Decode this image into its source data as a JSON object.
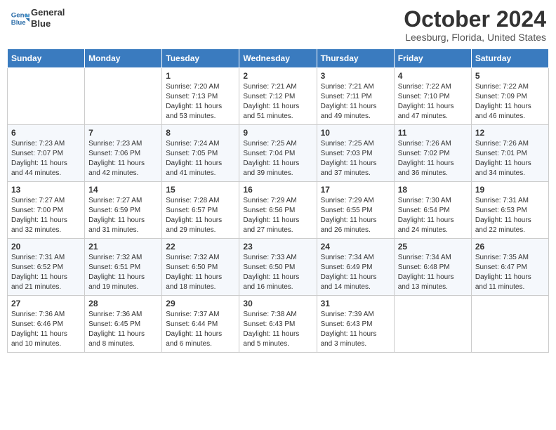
{
  "header": {
    "logo_line1": "General",
    "logo_line2": "Blue",
    "month": "October 2024",
    "location": "Leesburg, Florida, United States"
  },
  "days_of_week": [
    "Sunday",
    "Monday",
    "Tuesday",
    "Wednesday",
    "Thursday",
    "Friday",
    "Saturday"
  ],
  "weeks": [
    [
      {
        "day": "",
        "sunrise": "",
        "sunset": "",
        "daylight": ""
      },
      {
        "day": "",
        "sunrise": "",
        "sunset": "",
        "daylight": ""
      },
      {
        "day": "1",
        "sunrise": "Sunrise: 7:20 AM",
        "sunset": "Sunset: 7:13 PM",
        "daylight": "Daylight: 11 hours and 53 minutes."
      },
      {
        "day": "2",
        "sunrise": "Sunrise: 7:21 AM",
        "sunset": "Sunset: 7:12 PM",
        "daylight": "Daylight: 11 hours and 51 minutes."
      },
      {
        "day": "3",
        "sunrise": "Sunrise: 7:21 AM",
        "sunset": "Sunset: 7:11 PM",
        "daylight": "Daylight: 11 hours and 49 minutes."
      },
      {
        "day": "4",
        "sunrise": "Sunrise: 7:22 AM",
        "sunset": "Sunset: 7:10 PM",
        "daylight": "Daylight: 11 hours and 47 minutes."
      },
      {
        "day": "5",
        "sunrise": "Sunrise: 7:22 AM",
        "sunset": "Sunset: 7:09 PM",
        "daylight": "Daylight: 11 hours and 46 minutes."
      }
    ],
    [
      {
        "day": "6",
        "sunrise": "Sunrise: 7:23 AM",
        "sunset": "Sunset: 7:07 PM",
        "daylight": "Daylight: 11 hours and 44 minutes."
      },
      {
        "day": "7",
        "sunrise": "Sunrise: 7:23 AM",
        "sunset": "Sunset: 7:06 PM",
        "daylight": "Daylight: 11 hours and 42 minutes."
      },
      {
        "day": "8",
        "sunrise": "Sunrise: 7:24 AM",
        "sunset": "Sunset: 7:05 PM",
        "daylight": "Daylight: 11 hours and 41 minutes."
      },
      {
        "day": "9",
        "sunrise": "Sunrise: 7:25 AM",
        "sunset": "Sunset: 7:04 PM",
        "daylight": "Daylight: 11 hours and 39 minutes."
      },
      {
        "day": "10",
        "sunrise": "Sunrise: 7:25 AM",
        "sunset": "Sunset: 7:03 PM",
        "daylight": "Daylight: 11 hours and 37 minutes."
      },
      {
        "day": "11",
        "sunrise": "Sunrise: 7:26 AM",
        "sunset": "Sunset: 7:02 PM",
        "daylight": "Daylight: 11 hours and 36 minutes."
      },
      {
        "day": "12",
        "sunrise": "Sunrise: 7:26 AM",
        "sunset": "Sunset: 7:01 PM",
        "daylight": "Daylight: 11 hours and 34 minutes."
      }
    ],
    [
      {
        "day": "13",
        "sunrise": "Sunrise: 7:27 AM",
        "sunset": "Sunset: 7:00 PM",
        "daylight": "Daylight: 11 hours and 32 minutes."
      },
      {
        "day": "14",
        "sunrise": "Sunrise: 7:27 AM",
        "sunset": "Sunset: 6:59 PM",
        "daylight": "Daylight: 11 hours and 31 minutes."
      },
      {
        "day": "15",
        "sunrise": "Sunrise: 7:28 AM",
        "sunset": "Sunset: 6:57 PM",
        "daylight": "Daylight: 11 hours and 29 minutes."
      },
      {
        "day": "16",
        "sunrise": "Sunrise: 7:29 AM",
        "sunset": "Sunset: 6:56 PM",
        "daylight": "Daylight: 11 hours and 27 minutes."
      },
      {
        "day": "17",
        "sunrise": "Sunrise: 7:29 AM",
        "sunset": "Sunset: 6:55 PM",
        "daylight": "Daylight: 11 hours and 26 minutes."
      },
      {
        "day": "18",
        "sunrise": "Sunrise: 7:30 AM",
        "sunset": "Sunset: 6:54 PM",
        "daylight": "Daylight: 11 hours and 24 minutes."
      },
      {
        "day": "19",
        "sunrise": "Sunrise: 7:31 AM",
        "sunset": "Sunset: 6:53 PM",
        "daylight": "Daylight: 11 hours and 22 minutes."
      }
    ],
    [
      {
        "day": "20",
        "sunrise": "Sunrise: 7:31 AM",
        "sunset": "Sunset: 6:52 PM",
        "daylight": "Daylight: 11 hours and 21 minutes."
      },
      {
        "day": "21",
        "sunrise": "Sunrise: 7:32 AM",
        "sunset": "Sunset: 6:51 PM",
        "daylight": "Daylight: 11 hours and 19 minutes."
      },
      {
        "day": "22",
        "sunrise": "Sunrise: 7:32 AM",
        "sunset": "Sunset: 6:50 PM",
        "daylight": "Daylight: 11 hours and 18 minutes."
      },
      {
        "day": "23",
        "sunrise": "Sunrise: 7:33 AM",
        "sunset": "Sunset: 6:50 PM",
        "daylight": "Daylight: 11 hours and 16 minutes."
      },
      {
        "day": "24",
        "sunrise": "Sunrise: 7:34 AM",
        "sunset": "Sunset: 6:49 PM",
        "daylight": "Daylight: 11 hours and 14 minutes."
      },
      {
        "day": "25",
        "sunrise": "Sunrise: 7:34 AM",
        "sunset": "Sunset: 6:48 PM",
        "daylight": "Daylight: 11 hours and 13 minutes."
      },
      {
        "day": "26",
        "sunrise": "Sunrise: 7:35 AM",
        "sunset": "Sunset: 6:47 PM",
        "daylight": "Daylight: 11 hours and 11 minutes."
      }
    ],
    [
      {
        "day": "27",
        "sunrise": "Sunrise: 7:36 AM",
        "sunset": "Sunset: 6:46 PM",
        "daylight": "Daylight: 11 hours and 10 minutes."
      },
      {
        "day": "28",
        "sunrise": "Sunrise: 7:36 AM",
        "sunset": "Sunset: 6:45 PM",
        "daylight": "Daylight: 11 hours and 8 minutes."
      },
      {
        "day": "29",
        "sunrise": "Sunrise: 7:37 AM",
        "sunset": "Sunset: 6:44 PM",
        "daylight": "Daylight: 11 hours and 6 minutes."
      },
      {
        "day": "30",
        "sunrise": "Sunrise: 7:38 AM",
        "sunset": "Sunset: 6:43 PM",
        "daylight": "Daylight: 11 hours and 5 minutes."
      },
      {
        "day": "31",
        "sunrise": "Sunrise: 7:39 AM",
        "sunset": "Sunset: 6:43 PM",
        "daylight": "Daylight: 11 hours and 3 minutes."
      },
      {
        "day": "",
        "sunrise": "",
        "sunset": "",
        "daylight": ""
      },
      {
        "day": "",
        "sunrise": "",
        "sunset": "",
        "daylight": ""
      }
    ]
  ]
}
